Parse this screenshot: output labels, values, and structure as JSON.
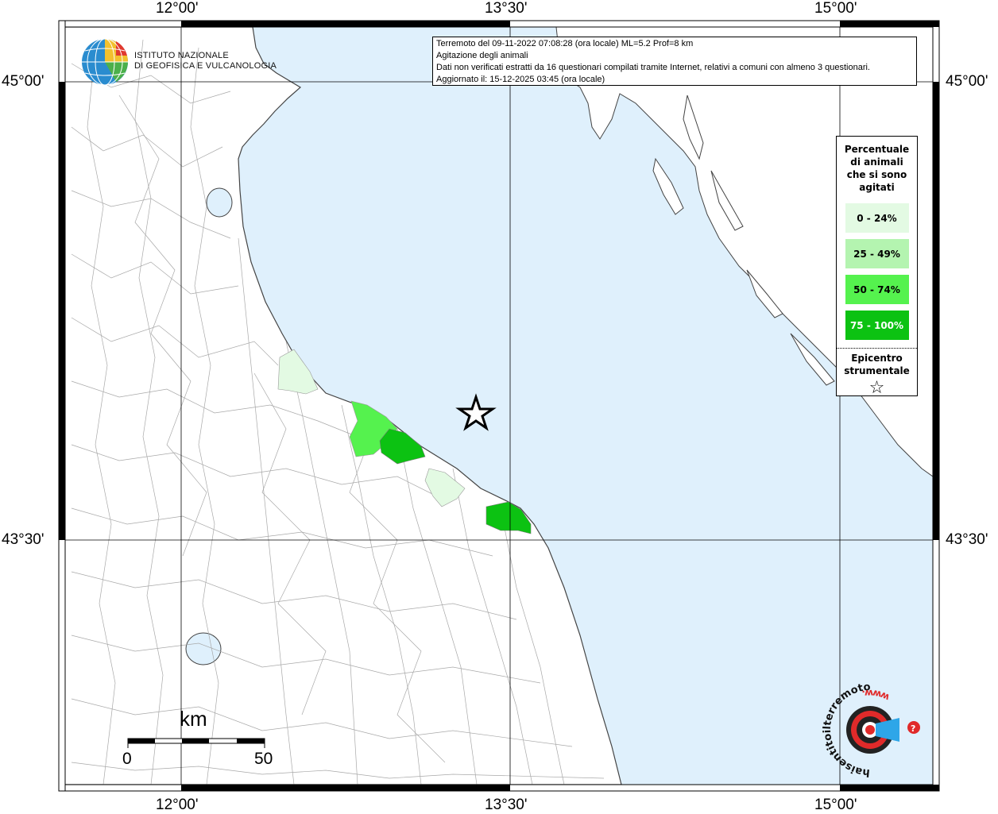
{
  "info": {
    "line1": "Terremoto del 09-11-2022 07:08:28 (ora locale) ML=5.2 Prof=8 km",
    "line2": "Agitazione degli animali",
    "line3": "Dati non verificati estratti da 16 questionari compilati tramite Internet, relativi a comuni con almeno 3 questionari.",
    "line4": "Aggiornato il: 15-12-2025 03:45 (ora locale)"
  },
  "axes": {
    "lon_labels": [
      "12°00'",
      "13°30'",
      "15°00'"
    ],
    "lat_labels": [
      "45°00'",
      "43°30'"
    ]
  },
  "logo": {
    "line1": "ISTITUTO NAZIONALE",
    "line2": "DI GEOFISICA E VULCANOLOGIA"
  },
  "legend": {
    "title_line1": "Percentuale",
    "title_line2": "di animali",
    "title_line3": "che si sono",
    "title_line4": "agitati",
    "items": [
      {
        "label": "0 - 24%",
        "color": "#e3fae3",
        "text_color": "#000000"
      },
      {
        "label": "25 - 49%",
        "color": "#b4f4b0",
        "text_color": "#000000"
      },
      {
        "label": "50 - 74%",
        "color": "#55f24e",
        "text_color": "#000000"
      },
      {
        "label": "75 - 100%",
        "color": "#0cc212",
        "text_color": "#ffffff"
      }
    ],
    "epi_line1": "Epicentro",
    "epi_line2": "strumentale",
    "epi_symbol": "☆"
  },
  "scale": {
    "unit": "km",
    "start": "0",
    "end": "50"
  },
  "badge": {
    "text": "haisentitoilterremoto.it",
    "text2": "www."
  },
  "colors": {
    "sea": "#dff0fc",
    "land": "#ffffff",
    "boundary": "#9a9a9a"
  }
}
